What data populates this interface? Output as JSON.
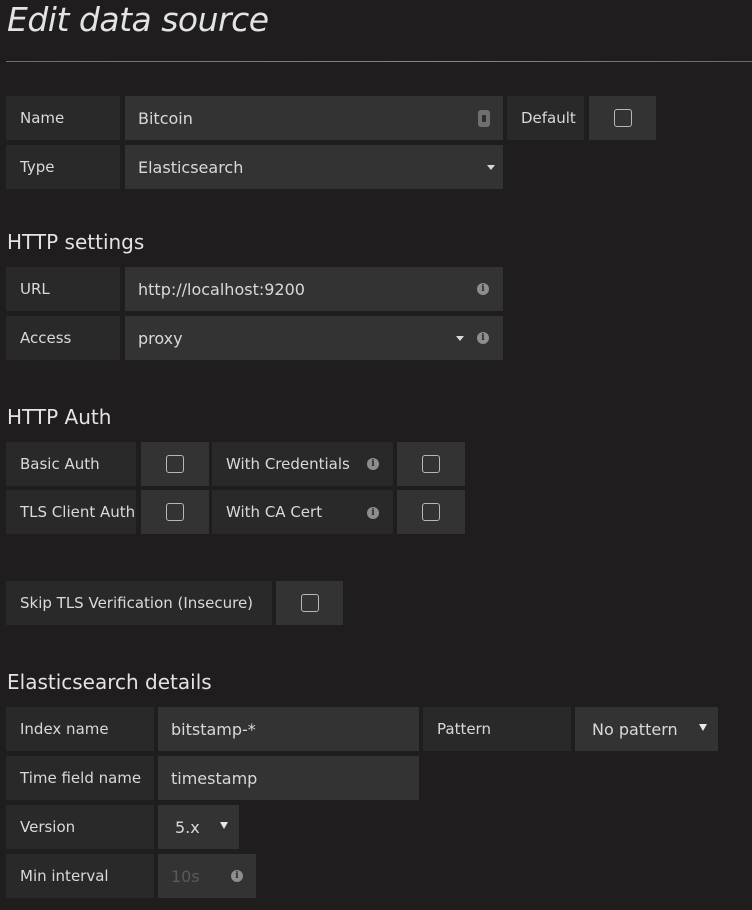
{
  "page": {
    "title": "Edit data source"
  },
  "general": {
    "name_label": "Name",
    "name_value": "Bitcoin",
    "default_label": "Default",
    "type_label": "Type",
    "type_value": "Elasticsearch"
  },
  "http_settings": {
    "heading": "HTTP settings",
    "url_label": "URL",
    "url_value": "http://localhost:9200",
    "access_label": "Access",
    "access_value": "proxy"
  },
  "http_auth": {
    "heading": "HTTP Auth",
    "basic_auth_label": "Basic Auth",
    "with_credentials_label": "With Credentials",
    "tls_client_auth_label": "TLS Client Auth",
    "with_ca_cert_label": "With CA Cert",
    "skip_tls_label": "Skip TLS Verification (Insecure)"
  },
  "elasticsearch": {
    "heading": "Elasticsearch details",
    "index_name_label": "Index name",
    "index_name_value": "bitstamp-*",
    "pattern_label": "Pattern",
    "pattern_value": "No pattern",
    "time_field_label": "Time field name",
    "time_field_value": "timestamp",
    "version_label": "Version",
    "version_value": "5.x",
    "min_interval_label": "Min interval",
    "min_interval_placeholder": "10s"
  }
}
